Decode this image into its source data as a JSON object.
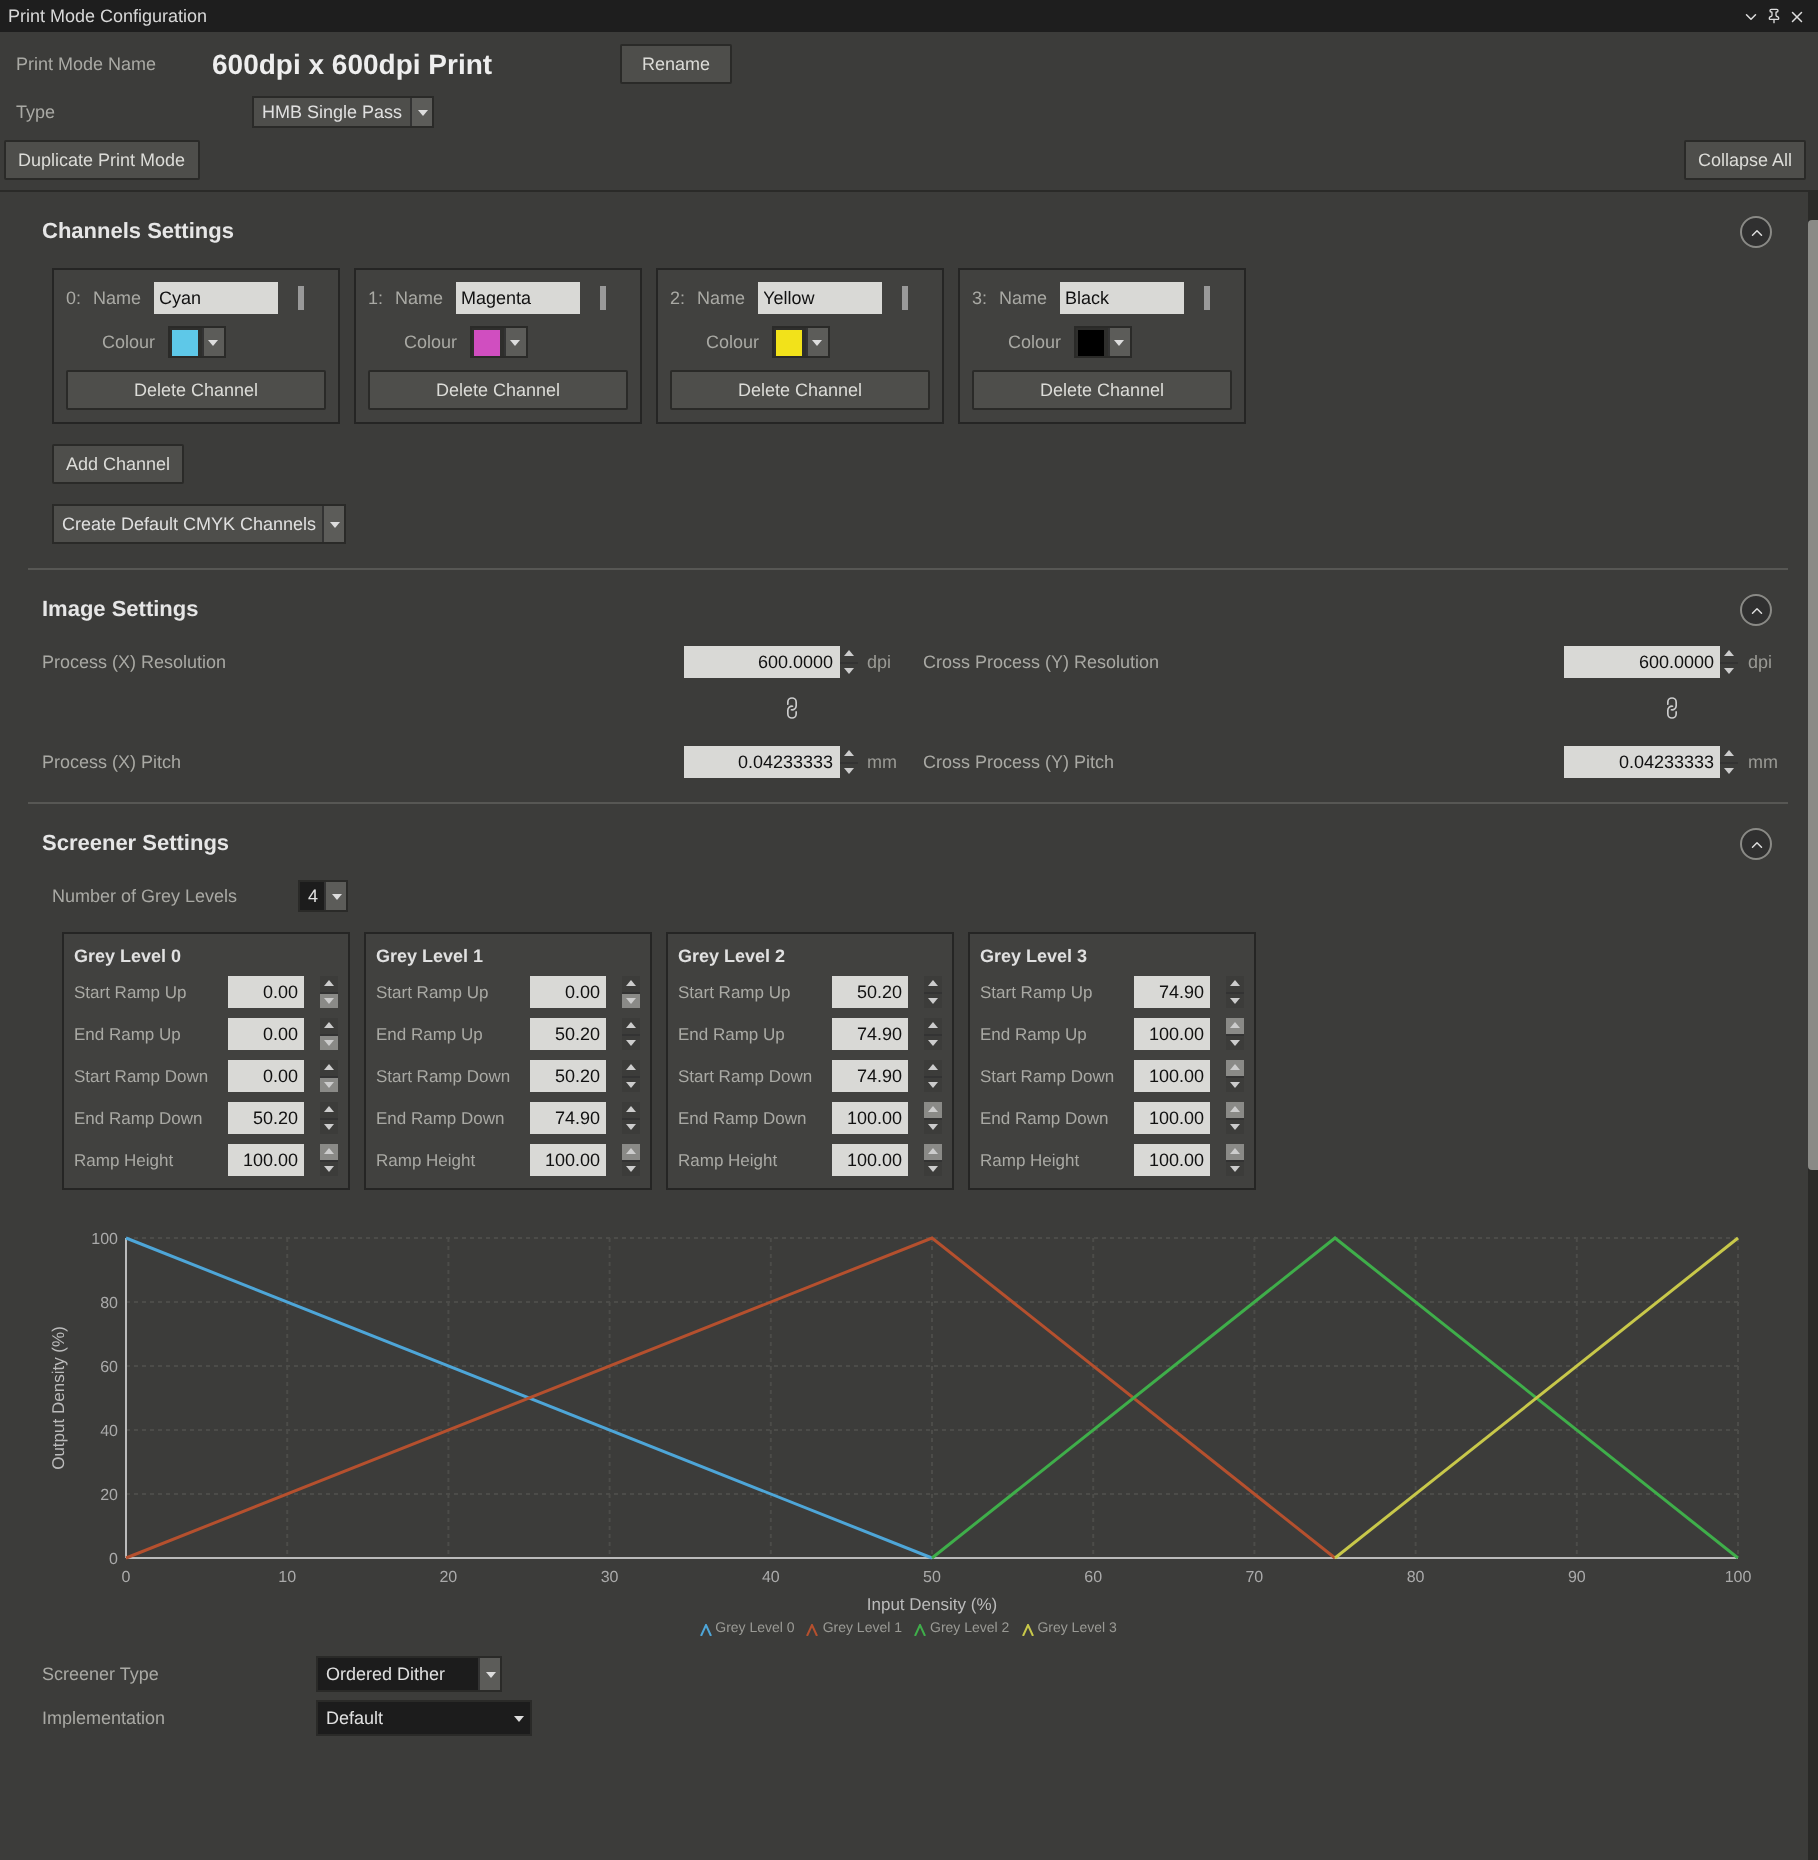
{
  "window": {
    "title": "Print Mode Configuration"
  },
  "print_mode": {
    "name_label": "Print Mode Name",
    "name": "600dpi x 600dpi Print",
    "rename_button": "Rename",
    "type_label": "Type",
    "type": "HMB Single Pass",
    "duplicate_button": "Duplicate Print Mode",
    "collapse_all_button": "Collapse All"
  },
  "channels_settings": {
    "title": "Channels Settings",
    "expanded": true,
    "channels": [
      {
        "index": "0:",
        "name_label": "Name",
        "name": "Cyan",
        "colour_label": "Colour",
        "color": "#5ec8e8",
        "delete_button": "Delete Channel"
      },
      {
        "index": "1:",
        "name_label": "Name",
        "name": "Magenta",
        "colour_label": "Colour",
        "color": "#d04ec0",
        "delete_button": "Delete Channel"
      },
      {
        "index": "2:",
        "name_label": "Name",
        "name": "Yellow",
        "colour_label": "Colour",
        "color": "#f2e21a",
        "delete_button": "Delete Channel"
      },
      {
        "index": "3:",
        "name_label": "Name",
        "name": "Black",
        "colour_label": "Colour",
        "color": "#000000",
        "delete_button": "Delete Channel"
      }
    ],
    "add_button": "Add Channel",
    "default_button": "Create Default CMYK Channels"
  },
  "image_settings": {
    "title": "Image Settings",
    "expanded": true,
    "rows": [
      {
        "label": "Process (X) Resolution",
        "value": "600.0000",
        "unit": "dpi",
        "label_2": "Cross Process (Y) Resolution",
        "value_2": "600.0000",
        "unit_2": "dpi"
      },
      {
        "label": "Process (X) Pitch",
        "value": "0.04233333",
        "unit": "mm",
        "label_2": "Cross Process (Y) Pitch",
        "value_2": "0.04233333",
        "unit_2": "mm"
      }
    ]
  },
  "screener_settings": {
    "title": "Screener Settings",
    "expanded": true,
    "grey_levels_label": "Number of Grey Levels",
    "grey_levels": "4",
    "levels": [
      {
        "title": "Grey Level 0",
        "fields": [
          {
            "label": "Start Ramp Up",
            "value": "0.00",
            "up_disabled": false,
            "down_disabled": true
          },
          {
            "label": "End Ramp Up",
            "value": "0.00",
            "up_disabled": false,
            "down_disabled": true
          },
          {
            "label": "Start Ramp Down",
            "value": "0.00",
            "up_disabled": false,
            "down_disabled": true
          },
          {
            "label": "End Ramp Down",
            "value": "50.20",
            "up_disabled": false,
            "down_disabled": false
          },
          {
            "label": "Ramp Height",
            "value": "100.00",
            "up_disabled": true,
            "down_disabled": false
          }
        ]
      },
      {
        "title": "Grey Level 1",
        "fields": [
          {
            "label": "Start Ramp Up",
            "value": "0.00",
            "up_disabled": false,
            "down_disabled": true
          },
          {
            "label": "End Ramp Up",
            "value": "50.20",
            "up_disabled": false,
            "down_disabled": false
          },
          {
            "label": "Start Ramp Down",
            "value": "50.20",
            "up_disabled": false,
            "down_disabled": false
          },
          {
            "label": "End Ramp Down",
            "value": "74.90",
            "up_disabled": false,
            "down_disabled": false
          },
          {
            "label": "Ramp Height",
            "value": "100.00",
            "up_disabled": true,
            "down_disabled": false
          }
        ]
      },
      {
        "title": "Grey Level 2",
        "fields": [
          {
            "label": "Start Ramp Up",
            "value": "50.20",
            "up_disabled": false,
            "down_disabled": false
          },
          {
            "label": "End Ramp Up",
            "value": "74.90",
            "up_disabled": false,
            "down_disabled": false
          },
          {
            "label": "Start Ramp Down",
            "value": "74.90",
            "up_disabled": false,
            "down_disabled": false
          },
          {
            "label": "End Ramp Down",
            "value": "100.00",
            "up_disabled": true,
            "down_disabled": false
          },
          {
            "label": "Ramp Height",
            "value": "100.00",
            "up_disabled": true,
            "down_disabled": false
          }
        ]
      },
      {
        "title": "Grey Level 3",
        "fields": [
          {
            "label": "Start Ramp Up",
            "value": "74.90",
            "up_disabled": false,
            "down_disabled": false
          },
          {
            "label": "End Ramp Up",
            "value": "100.00",
            "up_disabled": true,
            "down_disabled": false
          },
          {
            "label": "Start Ramp Down",
            "value": "100.00",
            "up_disabled": true,
            "down_disabled": false
          },
          {
            "label": "End Ramp Down",
            "value": "100.00",
            "up_disabled": true,
            "down_disabled": false
          },
          {
            "label": "Ramp Height",
            "value": "100.00",
            "up_disabled": true,
            "down_disabled": false
          }
        ]
      }
    ],
    "chart_data": {
      "type": "line",
      "xlabel": "Input Density (%)",
      "ylabel": "Output Density (%)",
      "x": [
        0,
        50,
        75,
        100
      ],
      "series": [
        {
          "name": "Grey Level 0",
          "color": "#4ea6d8",
          "values": [
            100,
            0,
            null,
            null
          ]
        },
        {
          "name": "Grey Level 1",
          "color": "#b5502e",
          "values": [
            0,
            100,
            0,
            null
          ]
        },
        {
          "name": "Grey Level 2",
          "color": "#3fae4a",
          "values": [
            null,
            0,
            100,
            0
          ]
        },
        {
          "name": "Grey Level 3",
          "color": "#c8c84a",
          "values": [
            null,
            null,
            0,
            100
          ]
        }
      ],
      "grid": true,
      "legend": true,
      "xlim": [
        0,
        100
      ],
      "ylim": [
        0,
        100
      ],
      "xticks": [
        0,
        10,
        20,
        30,
        40,
        50,
        60,
        70,
        80,
        90,
        100
      ],
      "yticks": [
        0,
        20,
        40,
        60,
        80,
        100
      ]
    },
    "screener_type_label": "Screener Type",
    "screener_type": "Ordered Dither",
    "implementation_label": "Implementation",
    "implementation": "Default"
  }
}
